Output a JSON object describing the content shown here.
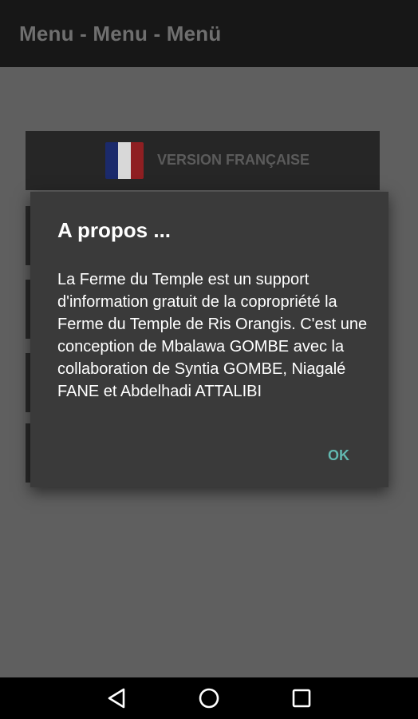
{
  "appbar": {
    "title": "Menu - Menu - Menü"
  },
  "menu": {
    "version_button": {
      "label": "VERSION FRANÇAISE",
      "icon": "france-flag-icon"
    }
  },
  "dialog": {
    "title": "A propos ...",
    "body": "La Ferme du Temple est un support d'information gratuit de la copropriété la Ferme du Temple de Ris Orangis. C'est une conception de Mbalawa GOMBE avec la collaboration de Syntia GOMBE, Niagalé FANE et Abdelhadi ATTALIBI",
    "ok_label": "OK"
  },
  "navbar": {
    "icons": [
      "back-icon",
      "home-icon",
      "recents-icon"
    ]
  },
  "colors": {
    "appbar": "#171717",
    "dialog_bg": "#3a3a3a",
    "accent": "#62b8b0",
    "scrim": "#5f5f5f"
  }
}
